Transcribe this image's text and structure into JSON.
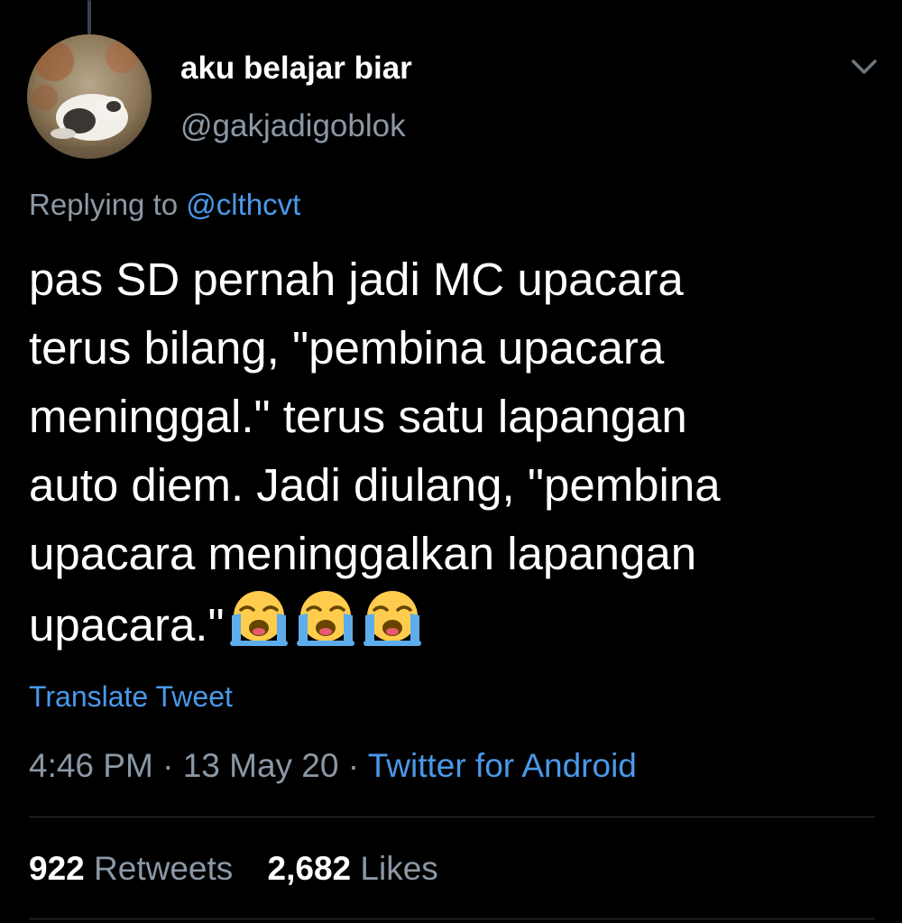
{
  "author": {
    "display_name": "aku belajar biar",
    "handle": "@gakjadigoblok"
  },
  "reply": {
    "prefix": "Replying to",
    "mention": "@clthcvt"
  },
  "tweet": {
    "lines": [
      "pas SD pernah jadi MC upacara",
      "terus bilang, \"pembina upacara",
      "meninggal.\" terus satu lapangan",
      "auto diem. Jadi diulang, \"pembina",
      "upacara meninggalkan lapangan",
      "upacara.\""
    ],
    "emojis": [
      "loudly-crying-face",
      "loudly-crying-face",
      "loudly-crying-face"
    ]
  },
  "translate_label": "Translate Tweet",
  "meta": {
    "time": "4:46 PM",
    "separator": " · ",
    "date": "13 May 20",
    "source": "Twitter for Android"
  },
  "stats": {
    "retweets_count": "922",
    "retweets_label": "Retweets",
    "likes_count": "2,682",
    "likes_label": "Likes"
  },
  "icons": {
    "menu": "chevron-down-icon",
    "avatar": "profile-photo-cat"
  },
  "colors": {
    "background": "#000000",
    "text_primary": "#ffffff",
    "text_secondary": "#8b98a5",
    "link": "#4a99e9"
  }
}
